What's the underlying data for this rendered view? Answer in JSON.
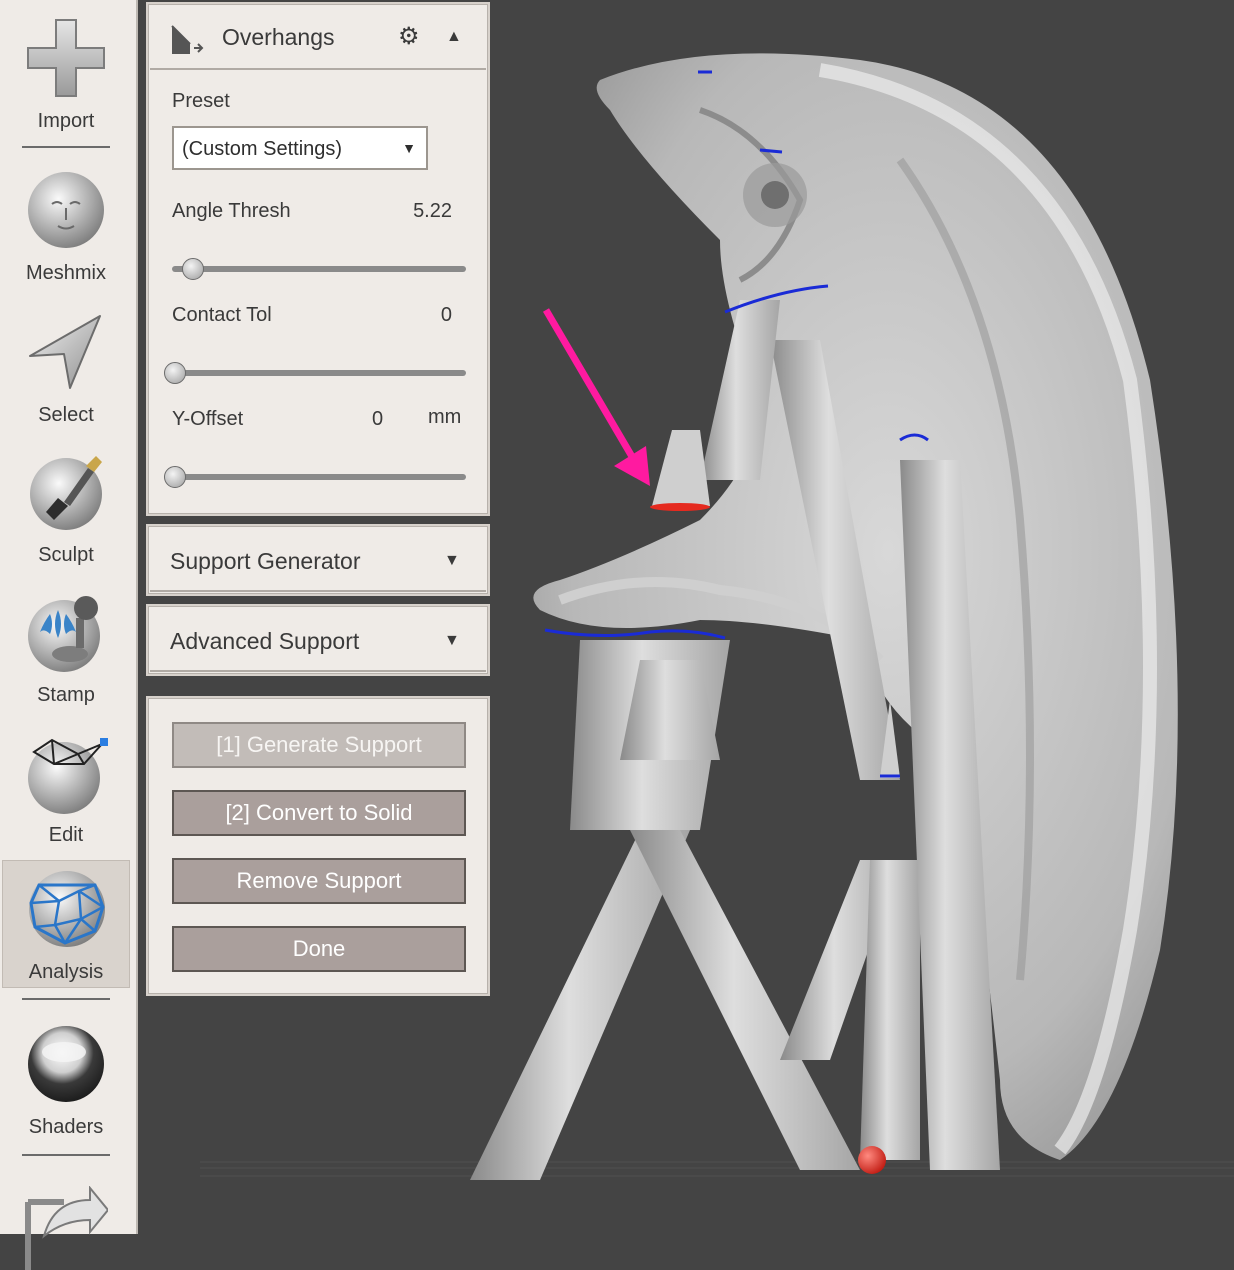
{
  "toolbar": {
    "items": [
      {
        "label": "Import",
        "icon": "plus-icon"
      },
      {
        "label": "Meshmix",
        "icon": "face-sphere-icon"
      },
      {
        "label": "Select",
        "icon": "arrow-cursor-icon"
      },
      {
        "label": "Sculpt",
        "icon": "brush-sphere-icon"
      },
      {
        "label": "Stamp",
        "icon": "stamp-icon"
      },
      {
        "label": "Edit",
        "icon": "edit-mesh-icon"
      },
      {
        "label": "Analysis",
        "icon": "analysis-mesh-icon"
      },
      {
        "label": "Shaders",
        "icon": "chrome-sphere-icon"
      }
    ],
    "active": "Analysis"
  },
  "overhangs": {
    "title": "Overhangs",
    "preset_label": "Preset",
    "preset_value": "(Custom Settings)",
    "angle_label": "Angle Thresh",
    "angle_value": "5.22",
    "angle_level": 0.06,
    "contact_label": "Contact Tol",
    "contact_value": "0",
    "contact_level": 0,
    "yoffset_label": "Y-Offset",
    "yoffset_value": "0",
    "yoffset_unit": "mm",
    "yoffset_level": 0
  },
  "support_generator": {
    "title": "Support Generator"
  },
  "advanced_support": {
    "title": "Advanced Support"
  },
  "actions": {
    "generate": "[1] Generate Support",
    "convert": "[2] Convert to Solid",
    "remove": "Remove Support",
    "done": "Done"
  },
  "colors": {
    "viewport_bg": "#444444",
    "panel_bg": "#efebe7",
    "button_bg": "#aa9f9c",
    "annotation_arrow": "#ff1aa0",
    "overhang_highlight": "#e52a1f",
    "support_edge": "#1a2bd6"
  }
}
